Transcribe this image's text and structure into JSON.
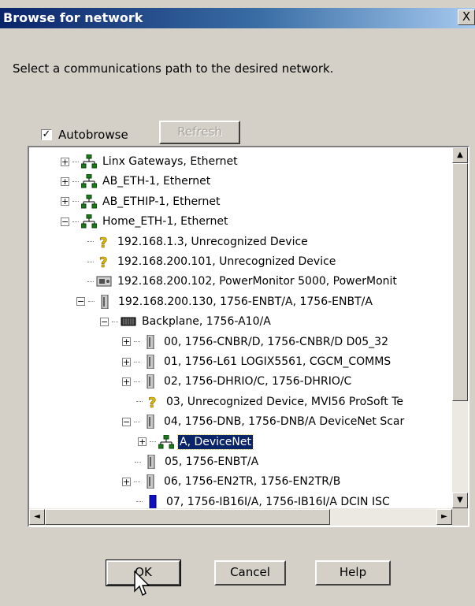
{
  "window": {
    "title": "Browse for network",
    "close_label": "X"
  },
  "instruction": "Select a communications path to the desired network.",
  "autobrowse": {
    "label": "Autobrowse",
    "checked": true,
    "check_mark": "✓"
  },
  "refresh_label": "Refresh",
  "tree": [
    {
      "label": "Linx Gateways, Ethernet",
      "icon": "network-icon",
      "expander": "+"
    },
    {
      "label": "AB_ETH-1, Ethernet",
      "icon": "network-icon",
      "expander": "+"
    },
    {
      "label": "AB_ETHIP-1, Ethernet",
      "icon": "network-icon",
      "expander": "+"
    },
    {
      "label": "Home_ETH-1, Ethernet",
      "icon": "network-icon",
      "expander": "−"
    },
    {
      "label": "192.168.1.3, Unrecognized Device",
      "icon": "unknown-device-icon",
      "expander": ""
    },
    {
      "label": "192.168.200.101, Unrecognized Device",
      "icon": "unknown-device-icon",
      "expander": ""
    },
    {
      "label": "192.168.200.102, PowerMonitor 5000, PowerMonit",
      "icon": "power-monitor-icon",
      "expander": ""
    },
    {
      "label": "192.168.200.130, 1756-ENBT/A, 1756-ENBT/A",
      "icon": "module-icon",
      "expander": "−"
    },
    {
      "label": "Backplane, 1756-A10/A",
      "icon": "backplane-icon",
      "expander": "−"
    },
    {
      "label": "00, 1756-CNBR/D, 1756-CNBR/D D05_32",
      "icon": "module-icon",
      "expander": "+"
    },
    {
      "label": "01, 1756-L61 LOGIX5561, CGCM_COMMS",
      "icon": "module-icon",
      "expander": "+"
    },
    {
      "label": "02, 1756-DHRIO/C, 1756-DHRIO/C",
      "icon": "module-icon",
      "expander": "+"
    },
    {
      "label": "03, Unrecognized Device, MVI56 ProSoft Te",
      "icon": "unknown-device-icon",
      "expander": ""
    },
    {
      "label": "04, 1756-DNB, 1756-DNB/A DeviceNet Scar",
      "icon": "module-icon",
      "expander": "−"
    },
    {
      "label": "A, DeviceNet",
      "icon": "network-icon",
      "expander": "+",
      "selected": true
    },
    {
      "label": "05, 1756-ENBT/A",
      "icon": "module-icon",
      "expander": ""
    },
    {
      "label": "06, 1756-EN2TR, 1756-EN2TR/B",
      "icon": "module-icon",
      "expander": "+"
    },
    {
      "label": "07, 1756-IB16I/A, 1756-IB16I/A DCIN ISC",
      "icon": "io-module-icon",
      "expander": ""
    }
  ],
  "scroll_arrows": {
    "up": "▲",
    "down": "▼",
    "left": "◄",
    "right": "►"
  },
  "buttons": {
    "ok": "OK",
    "cancel": "Cancel",
    "help": "Help"
  }
}
